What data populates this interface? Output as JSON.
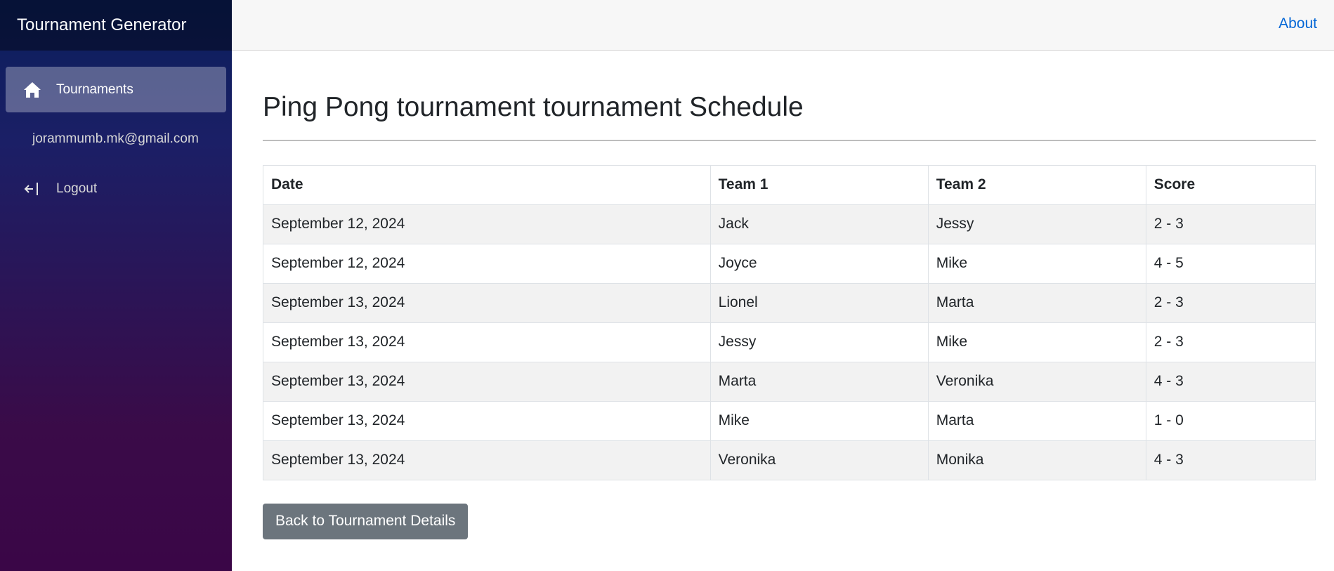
{
  "sidebar": {
    "brand": "Tournament Generator",
    "items": [
      {
        "label": "Tournaments",
        "icon": "home-icon",
        "active": true
      },
      {
        "label": "jorammumb.mk@gmail.com"
      },
      {
        "label": "Logout",
        "icon": "logout-icon"
      }
    ]
  },
  "topbar": {
    "about": "About"
  },
  "main": {
    "title": "Ping Pong tournament tournament Schedule",
    "table": {
      "headers": [
        "Date",
        "Team 1",
        "Team 2",
        "Score"
      ],
      "rows": [
        [
          "September 12, 2024",
          "Jack",
          "Jessy",
          "2 - 3"
        ],
        [
          "September 12, 2024",
          "Joyce",
          "Mike",
          "4 - 5"
        ],
        [
          "September 13, 2024",
          "Lionel",
          "Marta",
          "2 - 3"
        ],
        [
          "September 13, 2024",
          "Jessy",
          "Mike",
          "2 - 3"
        ],
        [
          "September 13, 2024",
          "Marta",
          "Veronika",
          "4 - 3"
        ],
        [
          "September 13, 2024",
          "Mike",
          "Marta",
          "1 - 0"
        ],
        [
          "September 13, 2024",
          "Veronika",
          "Monika",
          "4 - 3"
        ]
      ]
    },
    "back_button": "Back to Tournament Details"
  },
  "colors": {
    "link": "#0366d6",
    "button": "#6c757d"
  }
}
